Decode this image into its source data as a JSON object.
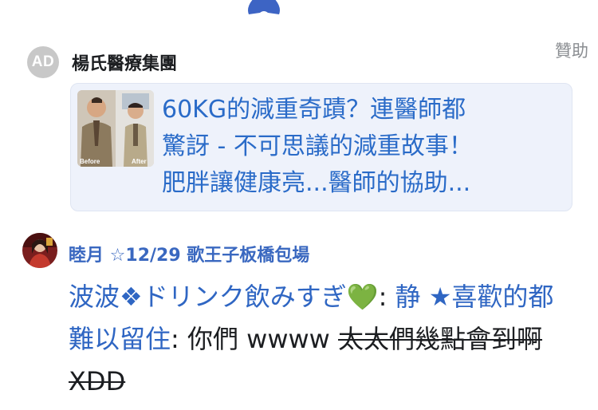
{
  "sponsored_label": "贊助",
  "ad": {
    "avatar_text": "AD",
    "name": "楊氏醫療集團",
    "thumb_before": "Before",
    "thumb_after": "After",
    "lines": [
      "60KG的減重奇蹟？連醫師都",
      "驚訝 - 不可思議的減重故事！",
      "肥胖讓健康亮...醫師的協助..."
    ]
  },
  "comment": {
    "author": "睦月 ☆12/29 歌王子板橋包場",
    "mention_1": "波波",
    "diamond": "❖",
    "mention_2": "ドリンク飲みすぎ",
    "heart": "💚",
    "colon_1": ": ",
    "mention_3": "静",
    "star": "★",
    "mention_4": "喜歡的都難以留住",
    "text_plain": ": 你們 wwww ",
    "text_strike": "太太們幾點會到啊 XDD"
  },
  "colors": {
    "link_blue": "#2f66c3",
    "card_bg": "#eef2fb",
    "muted": "#8a8d91"
  }
}
